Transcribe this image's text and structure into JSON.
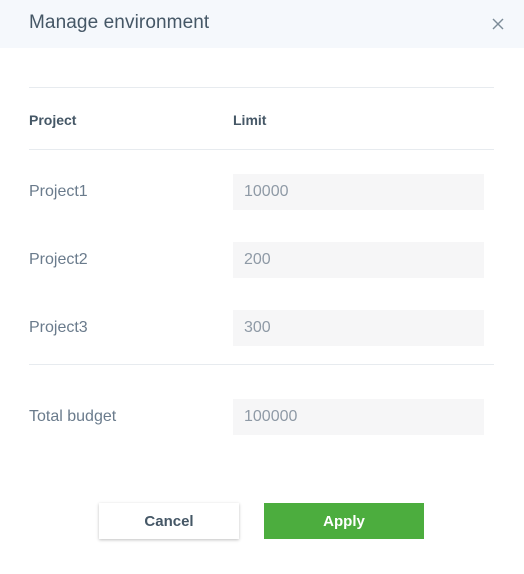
{
  "dialog": {
    "title": "Manage environment",
    "close_icon": "close-icon"
  },
  "table": {
    "columns": [
      "Project",
      "Limit"
    ],
    "rows": [
      {
        "project": "Project1",
        "limit": "10000"
      },
      {
        "project": "Project2",
        "limit": "200"
      },
      {
        "project": "Project3",
        "limit": "300"
      }
    ]
  },
  "total": {
    "label": "Total budget",
    "value": "100000"
  },
  "actions": {
    "cancel_label": "Cancel",
    "apply_label": "Apply"
  },
  "colors": {
    "header_bg": "#f5f8fc",
    "apply_bg": "#4cad3e",
    "field_bg": "#f6f6f7"
  }
}
